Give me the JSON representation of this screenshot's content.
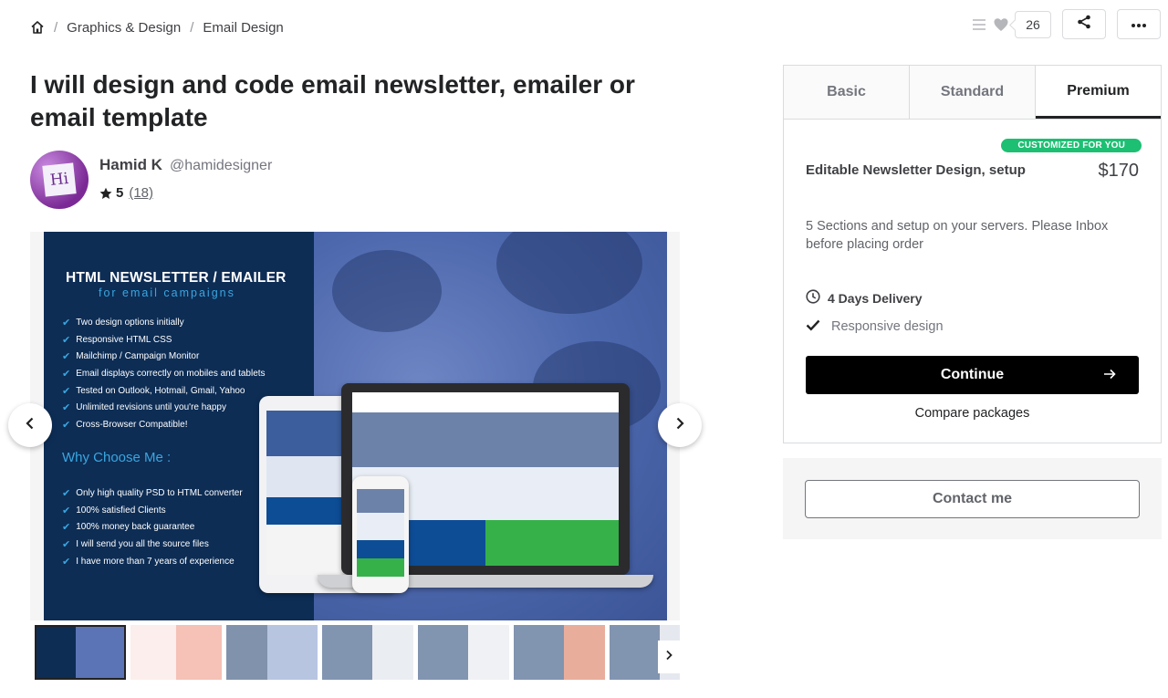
{
  "breadcrumb": {
    "items": [
      "Graphics & Design",
      "Email Design"
    ]
  },
  "favorites": {
    "count": "26"
  },
  "gig": {
    "title": "I will design and code email newsletter, emailer or email template"
  },
  "seller": {
    "avatar_text": "Hi",
    "name": "Hamid K",
    "handle": "@hamidesigner",
    "rating": "5",
    "reviews": "(18)"
  },
  "slide": {
    "heading": "HTML NEWSLETTER / EMAILER",
    "subheading": "for email campaigns",
    "features": [
      "Two design options initially",
      "Responsive HTML CSS",
      "Mailchimp / Campaign Monitor",
      "Email displays correctly on mobiles and tablets",
      "Tested on Outlook, Hotmail, Gmail, Yahoo",
      "Unlimited revisions until you're happy",
      "Cross-Browser Compatible!"
    ],
    "why_title": "Why Choose Me :",
    "reasons": [
      "Only high quality PSD to HTML converter",
      "100% satisfied Clients",
      "100% money back guarantee",
      "I will send you all the source files",
      "I have more than 7 years of experience"
    ]
  },
  "package": {
    "tabs": [
      "Basic",
      "Standard",
      "Premium"
    ],
    "selected_tab": "Premium",
    "badge": "CUSTOMIZED FOR YOU",
    "name": "Editable Newsletter Design, setup",
    "price": "$170",
    "description": "5 Sections and setup on your servers. Please Inbox before placing order",
    "delivery": "4 Days Delivery",
    "features": [
      "Responsive design"
    ],
    "continue_label": "Continue",
    "compare_label": "Compare packages"
  },
  "contact": {
    "label": "Contact me"
  },
  "colors": {
    "accent_green": "#1dbf73",
    "slide_navy": "#0d2d55",
    "slide_blue_text": "#3aa6e0",
    "button_black": "#000000"
  },
  "icons": [
    "home-icon",
    "menu-icon",
    "heart-icon",
    "share-icon",
    "more-icon",
    "star-icon",
    "chevron-left-icon",
    "chevron-right-icon",
    "clock-icon",
    "check-icon",
    "arrow-right-icon"
  ]
}
